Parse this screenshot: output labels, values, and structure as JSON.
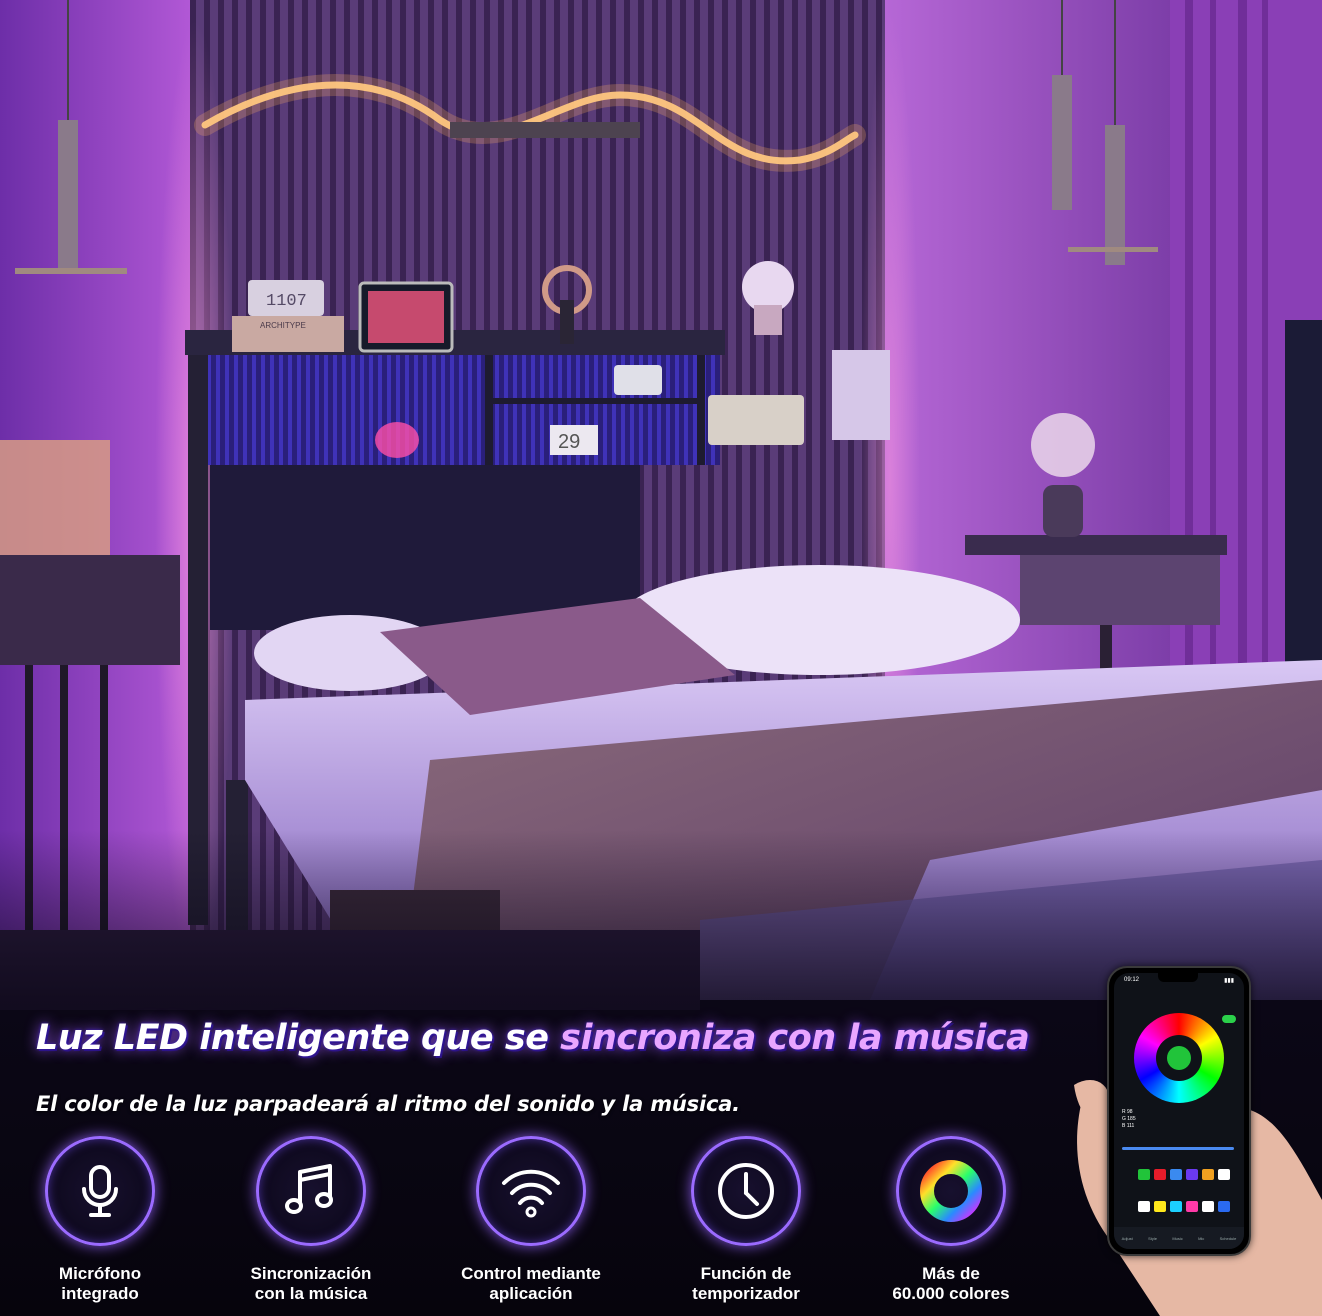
{
  "headline": {
    "part1": "Luz LED inteligente que se ",
    "part2": "sincroniza con la música"
  },
  "subline": "El color de la luz parpadeará al ritmo del sonido y la música.",
  "features": [
    {
      "icon": "microphone-icon",
      "line1": "Micrófono",
      "line2": "integrado"
    },
    {
      "icon": "music-note-icon",
      "line1": "Sincronización",
      "line2": "con la música"
    },
    {
      "icon": "wifi-icon",
      "line1": "Control mediante",
      "line2": "aplicación"
    },
    {
      "icon": "clock-icon",
      "line1": "Función de",
      "line2": "temporizador"
    },
    {
      "icon": "color-ring-icon",
      "line1": "Más de",
      "line2": "60.000 colores"
    }
  ],
  "scene": {
    "clock_display": "1107",
    "calendar": "29",
    "book_spine": "ARCHITYPE"
  },
  "phone": {
    "time": "09:12",
    "rgb": [
      "R 98",
      "G 185",
      "B 111"
    ],
    "tabs": [
      "Adjust",
      "Style",
      "Music",
      "Mic",
      "Schedule"
    ]
  },
  "colors": {
    "accent": "#9b6bff",
    "headline_accent": "#e9a6ff",
    "wall": "#9b4fd2",
    "led_glow": "#ff8ad8"
  }
}
